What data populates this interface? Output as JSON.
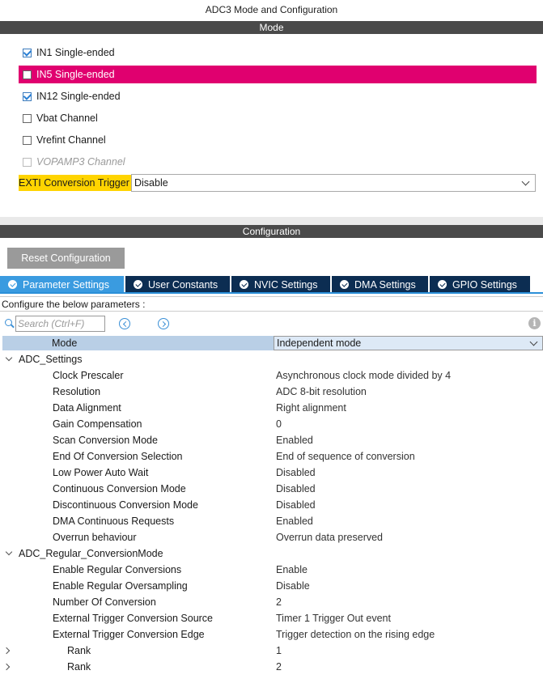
{
  "window": {
    "title": "ADC3 Mode and Configuration"
  },
  "mode_section": {
    "header": "Mode",
    "channels": [
      {
        "label": "IN1 Single-ended",
        "checked": true,
        "highlighted": false,
        "disabled": false
      },
      {
        "label": "IN5 Single-ended",
        "checked": false,
        "highlighted": true,
        "disabled": false
      },
      {
        "label": "IN12 Single-ended",
        "checked": true,
        "highlighted": false,
        "disabled": false
      },
      {
        "label": "Vbat Channel",
        "checked": false,
        "highlighted": false,
        "disabled": false
      },
      {
        "label": "Vrefint Channel",
        "checked": false,
        "highlighted": false,
        "disabled": false
      },
      {
        "label": "VOPAMP3 Channel",
        "checked": false,
        "highlighted": false,
        "disabled": true
      }
    ],
    "exti": {
      "label": "EXTI Conversion Trigger",
      "value": "Disable"
    }
  },
  "config_section": {
    "header": "Configuration",
    "reset_button": "Reset Configuration",
    "tabs": [
      {
        "label": "Parameter Settings",
        "active": true
      },
      {
        "label": "User Constants",
        "active": false
      },
      {
        "label": "NVIC Settings",
        "active": false
      },
      {
        "label": "DMA Settings",
        "active": false
      },
      {
        "label": "GPIO Settings",
        "active": false
      }
    ],
    "configure_label": "Configure the below parameters :",
    "search": {
      "placeholder": "Search (Ctrl+F)",
      "value": ""
    },
    "params": {
      "mode": {
        "key": "Mode",
        "value": "Independent mode"
      },
      "groups": [
        {
          "name": "ADC_Settings",
          "items": [
            {
              "key": "Clock Prescaler",
              "value": "Asynchronous clock mode divided by 4"
            },
            {
              "key": "Resolution",
              "value": "ADC 8-bit resolution"
            },
            {
              "key": "Data Alignment",
              "value": "Right alignment"
            },
            {
              "key": "Gain Compensation",
              "value": "0"
            },
            {
              "key": "Scan Conversion Mode",
              "value": "Enabled"
            },
            {
              "key": "End Of Conversion Selection",
              "value": "End of sequence of conversion"
            },
            {
              "key": "Low Power Auto Wait",
              "value": "Disabled"
            },
            {
              "key": "Continuous Conversion Mode",
              "value": "Disabled"
            },
            {
              "key": "Discontinuous Conversion Mode",
              "value": "Disabled"
            },
            {
              "key": "DMA Continuous Requests",
              "value": "Enabled"
            },
            {
              "key": "Overrun behaviour",
              "value": "Overrun data preserved"
            }
          ]
        },
        {
          "name": "ADC_Regular_ConversionMode",
          "items": [
            {
              "key": "Enable Regular Conversions",
              "value": "Enable"
            },
            {
              "key": "Enable Regular Oversampling",
              "value": "Disable"
            },
            {
              "key": "Number Of Conversion",
              "value": "2"
            },
            {
              "key": "External Trigger Conversion Source",
              "value": "Timer 1 Trigger Out event"
            },
            {
              "key": "External Trigger Conversion Edge",
              "value": "Trigger detection on the rising edge"
            }
          ],
          "ranks": [
            {
              "key": "Rank",
              "value": "1"
            },
            {
              "key": "Rank",
              "value": "2"
            }
          ]
        }
      ]
    }
  }
}
